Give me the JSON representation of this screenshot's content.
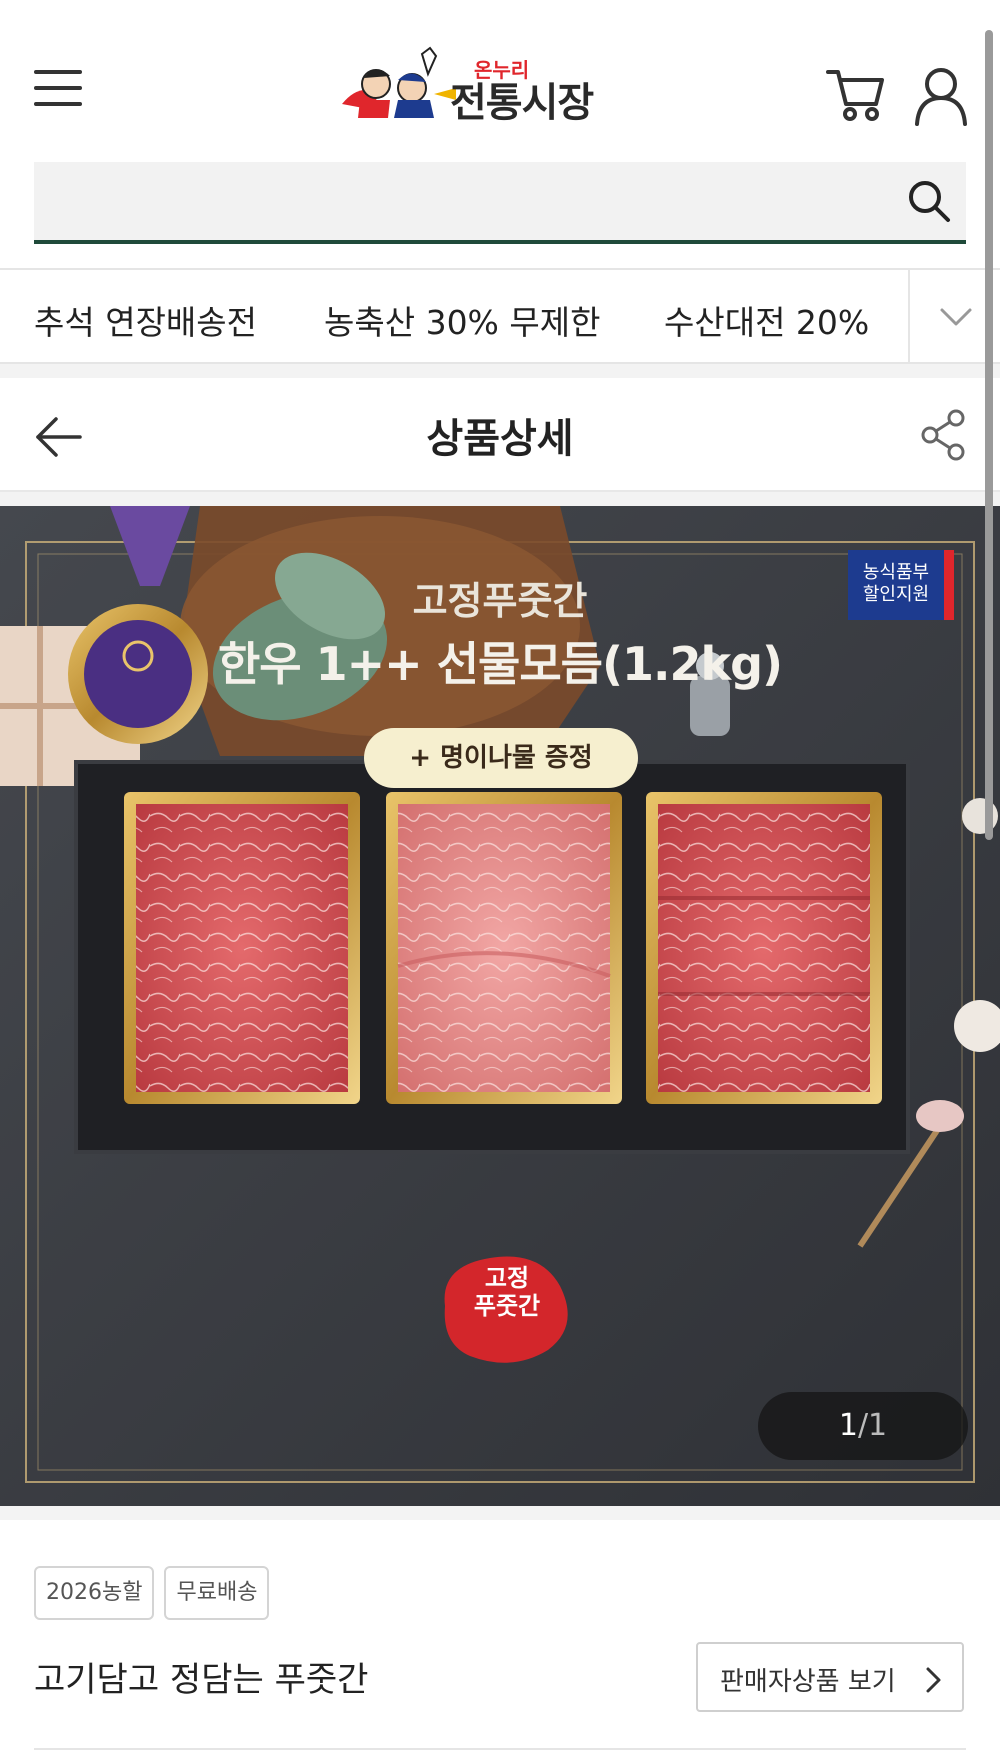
{
  "header": {
    "logo_main": "전통시장",
    "logo_sub": "온누리"
  },
  "search": {
    "placeholder": "",
    "value": ""
  },
  "categories": [
    {
      "label": "추석 연장배송전"
    },
    {
      "label": "농축산 30% 무제한"
    },
    {
      "label": "수산대전 20%"
    }
  ],
  "detail_header": {
    "title": "상품상세"
  },
  "product_image": {
    "brand_small": "고정푸줏간",
    "headline": "한우 1++ 선물모듬(1.2kg)",
    "gift_pill": "+ 명이나물 증정",
    "gov_badge_line1": "농식품부",
    "gov_badge_line2": "할인지원",
    "seal_line1": "고정",
    "seal_line2": "푸줏간",
    "page_current": "1",
    "page_total": "/1"
  },
  "badges": [
    "2026농할",
    "무료배송"
  ],
  "seller": {
    "name": "고기담고 정담는 푸줏간",
    "view_button_label": "판매자상품 보기"
  },
  "colors": {
    "search_underline": "#1f4a3a",
    "accent_red": "#e0262c",
    "gov_blue": "#1d3b8f"
  }
}
